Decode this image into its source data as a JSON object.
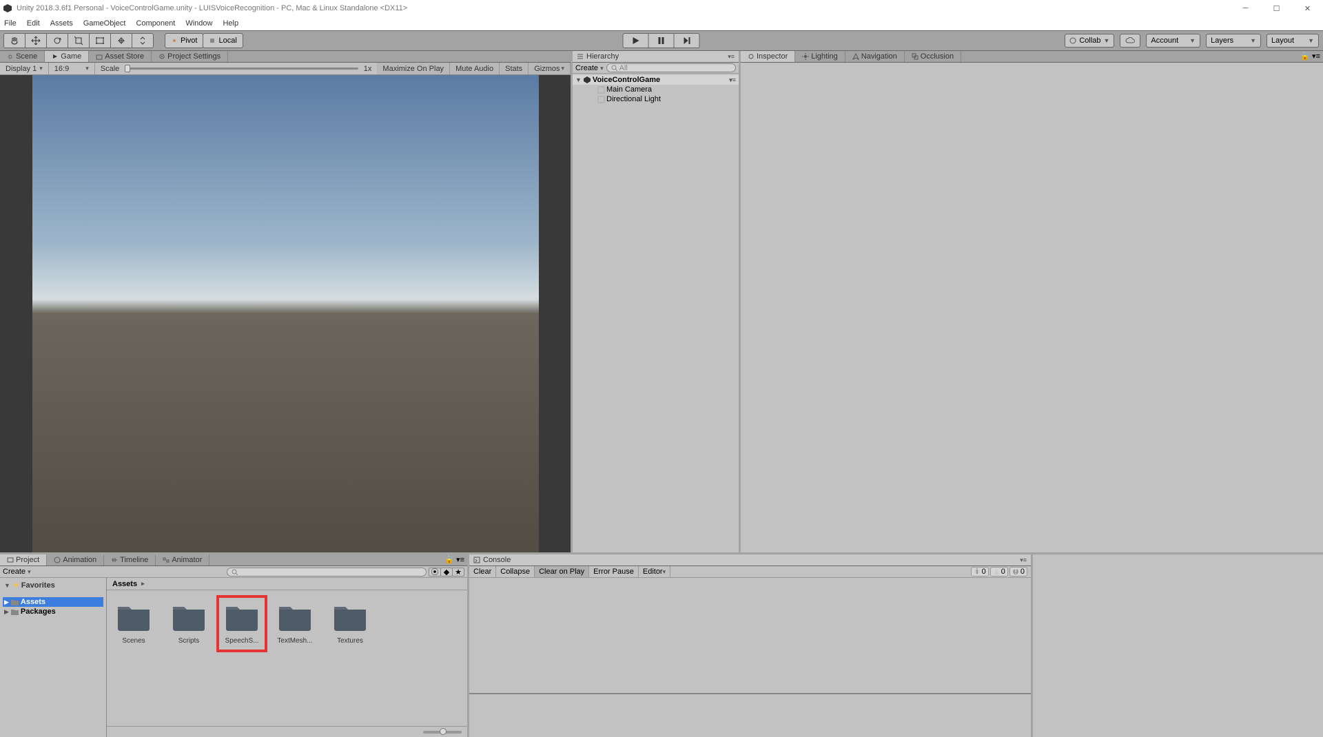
{
  "window": {
    "title": "Unity 2018.3.6f1 Personal - VoiceControlGame.unity - LUISVoiceRecognition - PC, Mac & Linux Standalone <DX11>"
  },
  "menu": {
    "items": [
      "File",
      "Edit",
      "Assets",
      "GameObject",
      "Component",
      "Window",
      "Help"
    ]
  },
  "toolbar": {
    "pivot": "Pivot",
    "local": "Local",
    "collab": "Collab",
    "account": "Account",
    "layers": "Layers",
    "layout": "Layout"
  },
  "game_tabs": {
    "scene": "Scene",
    "game": "Game",
    "asset_store": "Asset Store",
    "project_settings": "Project Settings"
  },
  "game_toolbar": {
    "display": "Display 1",
    "aspect": "16:9",
    "scale": "Scale",
    "scale_value": "1x",
    "maximize": "Maximize On Play",
    "mute": "Mute Audio",
    "stats": "Stats",
    "gizmos": "Gizmos"
  },
  "hierarchy": {
    "title": "Hierarchy",
    "create": "Create",
    "search_placeholder": "All",
    "scene_name": "VoiceControlGame",
    "items": [
      "Main Camera",
      "Directional Light"
    ]
  },
  "inspector": {
    "tabs": [
      "Inspector",
      "Lighting",
      "Navigation",
      "Occlusion"
    ]
  },
  "project": {
    "tabs": [
      "Project",
      "Animation",
      "Timeline",
      "Animator"
    ],
    "create": "Create",
    "favorites": "Favorites",
    "assets": "Assets",
    "packages": "Packages",
    "breadcrumb": "Assets",
    "folders": [
      "Scenes",
      "Scripts",
      "SpeechS...",
      "TextMesh...",
      "Textures"
    ]
  },
  "console": {
    "title": "Console",
    "clear": "Clear",
    "collapse": "Collapse",
    "clear_on_play": "Clear on Play",
    "error_pause": "Error Pause",
    "editor": "Editor",
    "count0": "0",
    "count1": "0",
    "count2": "0"
  }
}
